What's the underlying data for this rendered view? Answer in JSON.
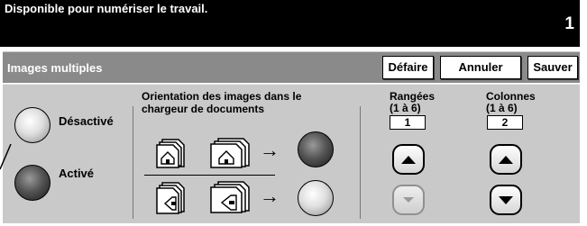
{
  "status": {
    "message": "Disponible pour numériser le travail.",
    "count": "1"
  },
  "header": {
    "title": "Images multiples"
  },
  "buttons": {
    "undo": "Défaire",
    "cancel": "Annuler",
    "save": "Sauver"
  },
  "mode": {
    "off_label": "Désactivé",
    "on_label": "Activé",
    "selected": "Activé"
  },
  "orientation": {
    "title_line1": "Orientation des images dans le",
    "title_line2": "chargeur de documents",
    "arrow": "→",
    "selected": "top"
  },
  "rows": {
    "label": "Rangées",
    "range": "(1 à 6)",
    "value": "1",
    "up_enabled": true,
    "down_enabled": false
  },
  "cols": {
    "label": "Colonnes",
    "range": "(1 à  6)",
    "value": "2",
    "up_enabled": true,
    "down_enabled": true
  },
  "colors": {
    "status_bg": "#000000",
    "title_bar": "#8a8a8a",
    "panel": "#c9c9c9"
  }
}
